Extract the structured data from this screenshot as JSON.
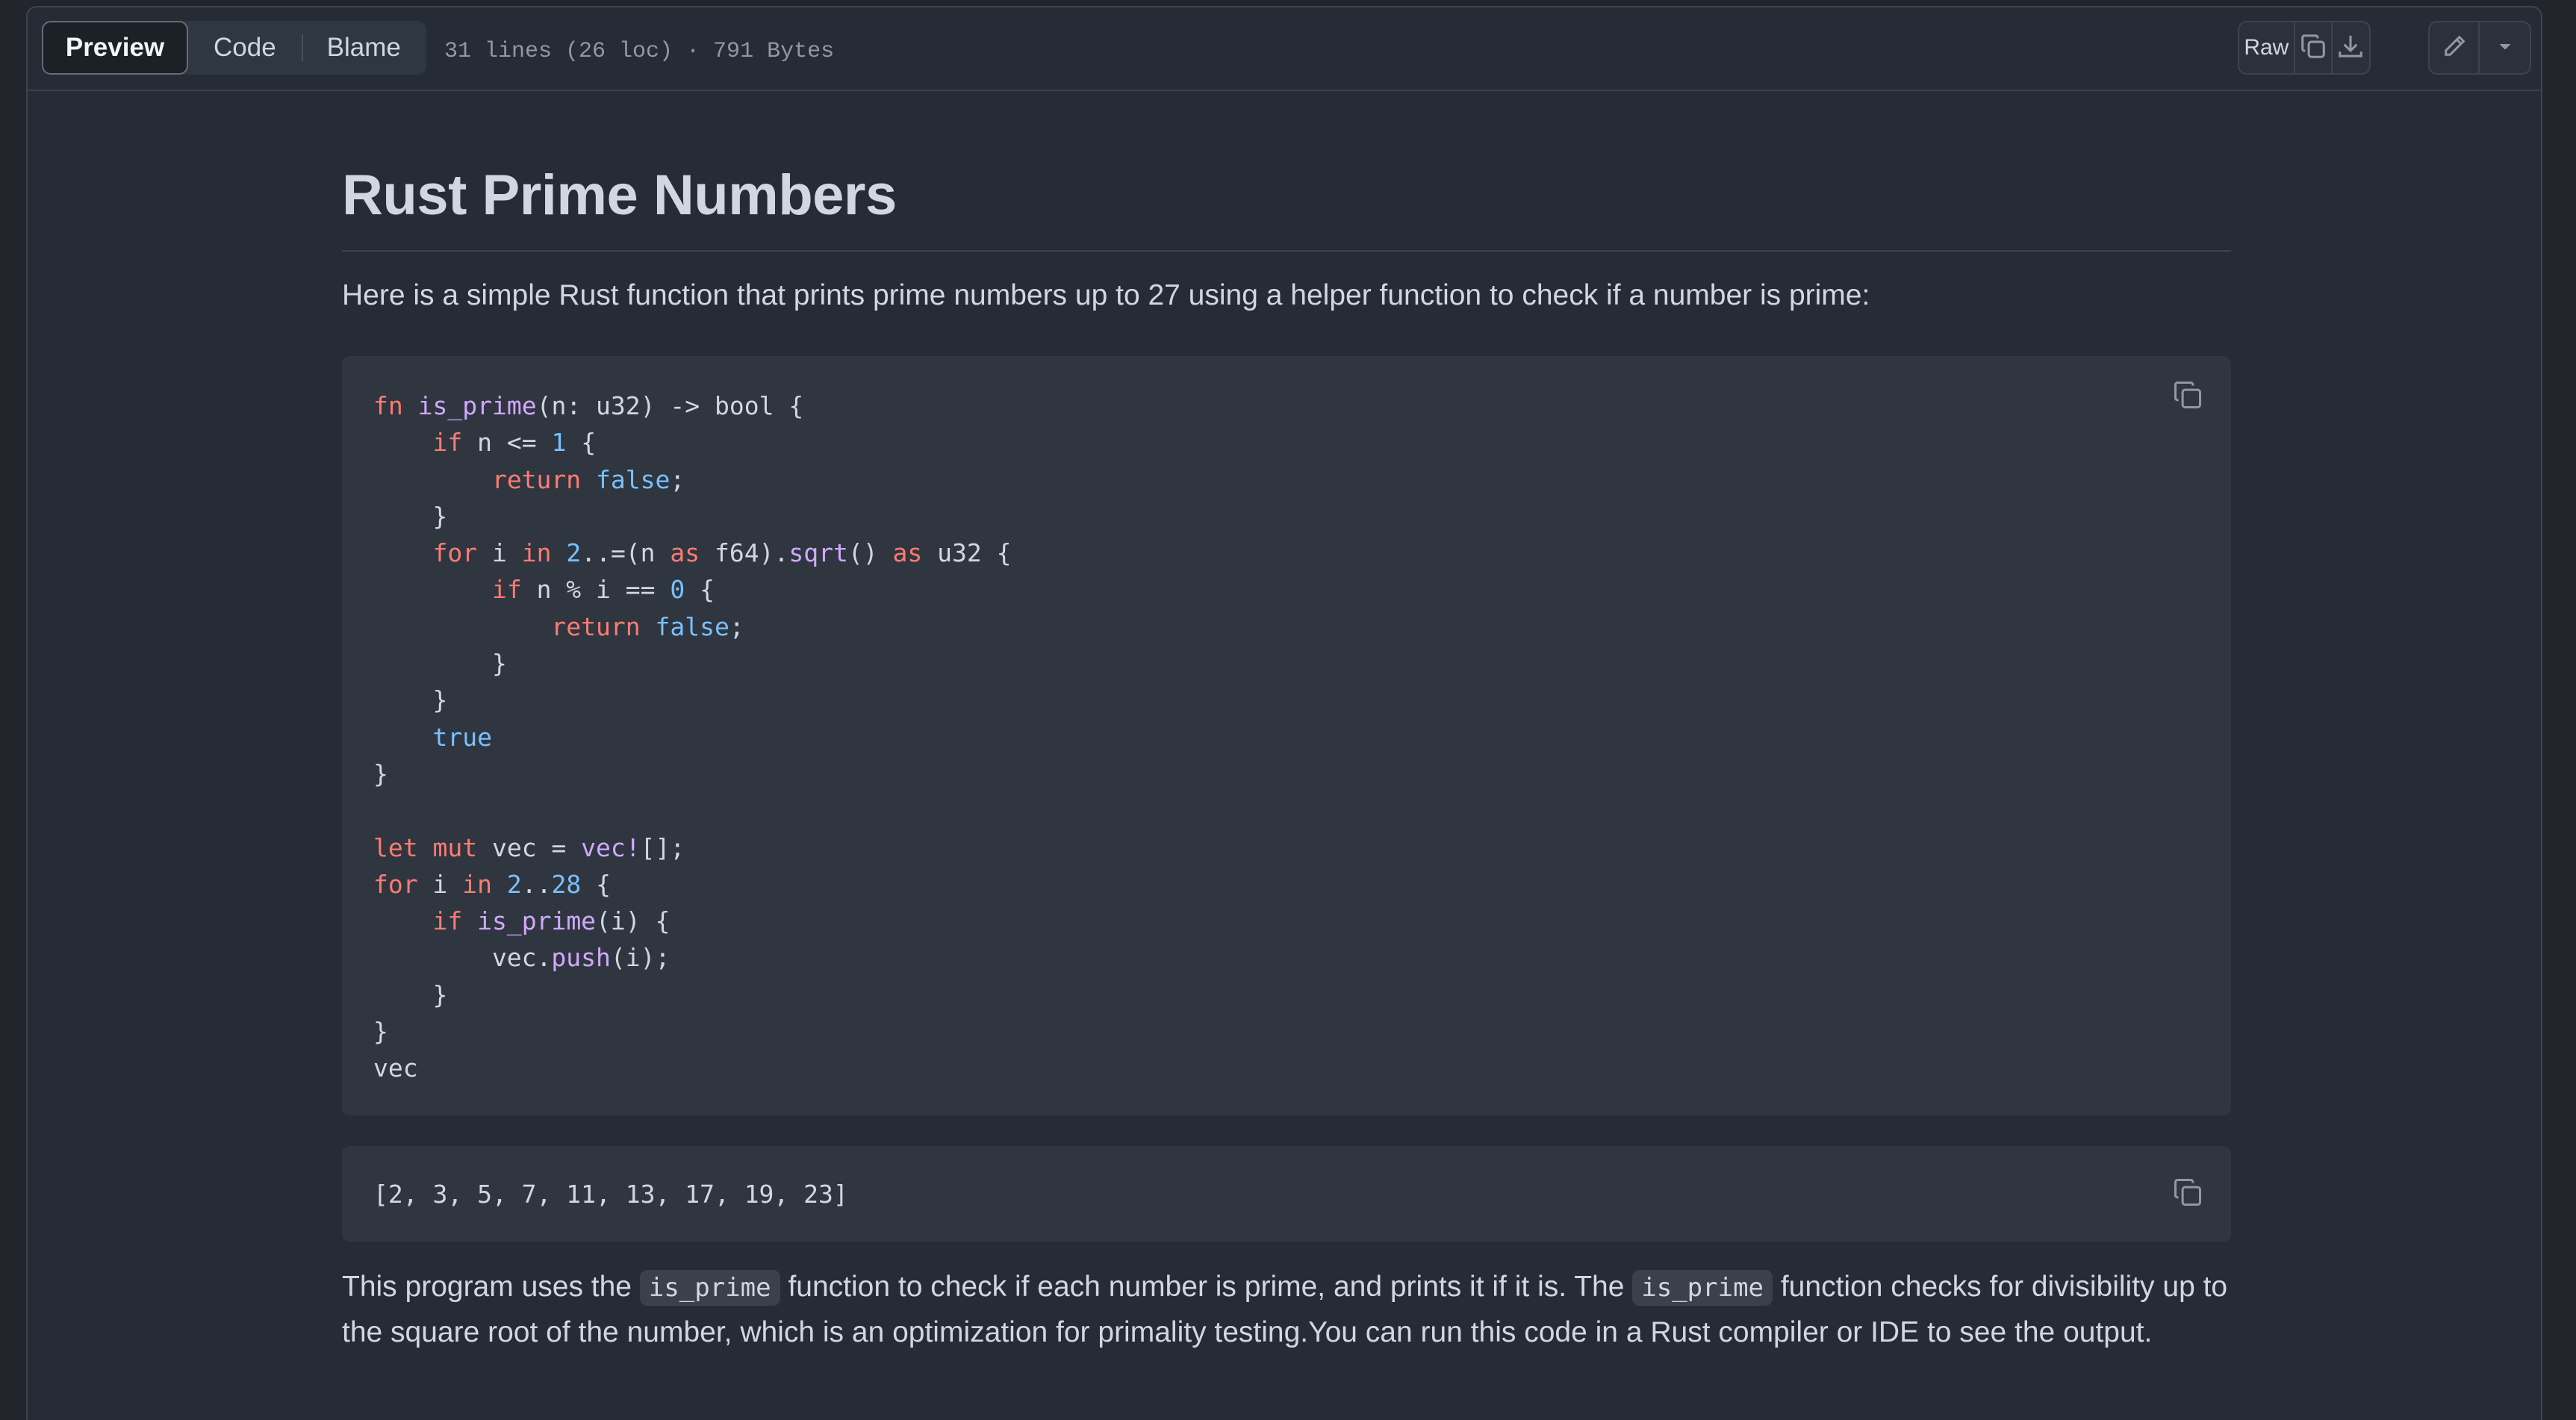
{
  "toolbar": {
    "tabs": [
      {
        "label": "Preview",
        "active": true
      },
      {
        "label": "Code",
        "active": false
      },
      {
        "label": "Blame",
        "active": false
      }
    ],
    "file_info": "31 lines (26 loc) · 791 Bytes",
    "raw_label": "Raw",
    "icons": [
      "copy-icon",
      "download-icon",
      "pencil-icon",
      "triangle-down-icon"
    ]
  },
  "document": {
    "title": "Rust Prime Numbers",
    "intro": "Here is a simple Rust function that prints prime numbers up to 27 using a helper function to check if a number is prime:",
    "code_lines": [
      "fn is_prime(n: u32) -> bool {",
      "    if n <= 1 {",
      "        return false;",
      "    }",
      "    for i in 2..=(n as f64).sqrt() as u32 {",
      "        if n % i == 0 {",
      "            return false;",
      "        }",
      "    }",
      "    true",
      "}",
      "",
      "let mut vec = vec![];",
      "for i in 2..28 {",
      "    if is_prime(i) {",
      "        vec.push(i);",
      "    }",
      "}",
      "vec"
    ],
    "output": "[2, 3, 5, 7, 11, 13, 17, 19, 23]",
    "outro": {
      "part1": "This program uses the ",
      "code1": "is_prime",
      "part2": " function to check if each number is prime, and prints it if it is. The ",
      "code2": "is_prime",
      "part3": " function checks for divisibility up to the square root of the number, which is an optimization for primality testing.You can run this code in a Rust compiler or IDE to see the output."
    }
  },
  "colors": {
    "keyword": "#ff7b72",
    "function": "#d2a8ff",
    "constant": "#79c0ff",
    "text": "#d1d7e0"
  }
}
